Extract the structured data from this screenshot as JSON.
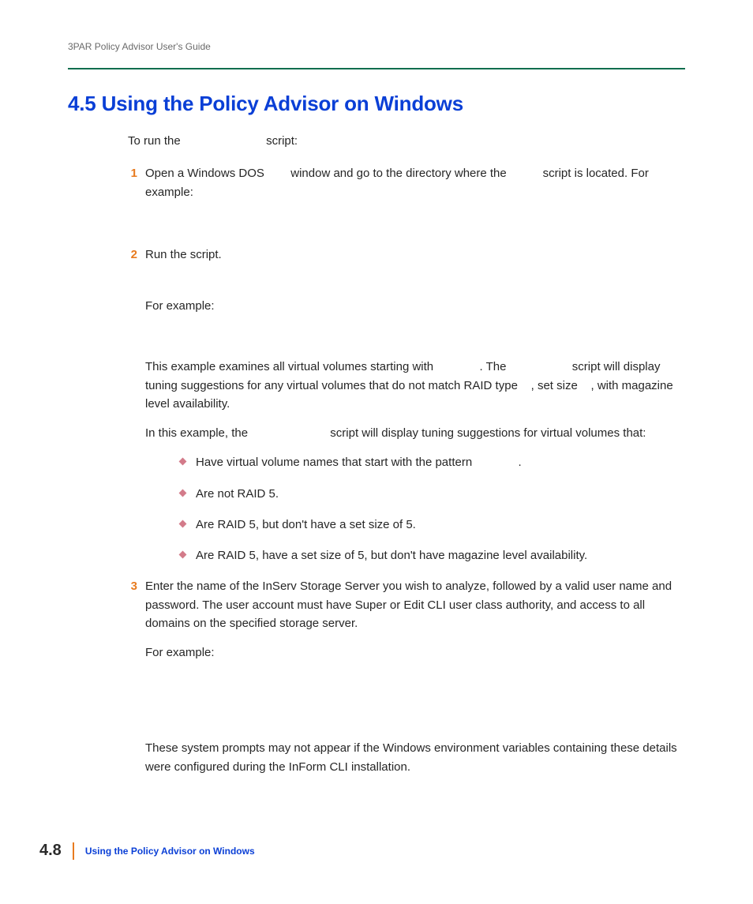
{
  "header": {
    "running": "3PAR Policy Advisor User's Guide"
  },
  "section": {
    "title": "4.5  Using the Policy Advisor on Windows"
  },
  "intro": {
    "pre": "To run the ",
    "post": " script:"
  },
  "steps": {
    "s1": {
      "num": "1",
      "pre": "Open a Windows DOS ",
      "mid": " window and go to the directory where the ",
      "post": "script is located. For example:"
    },
    "s2": {
      "num": "2",
      "line1": "Run the script.",
      "line2": "For example:",
      "p3a": "This example examines all virtual volumes starting with ",
      "p3b": ". The ",
      "p3c": "script will display tuning suggestions for any virtual volumes that do not match RAID type ",
      "p3d": ", set size ",
      "p3e": ", with magazine level availability.",
      "p4a": "In this example, the ",
      "p4b": " script will display tuning suggestions for virtual volumes that:",
      "bullets": {
        "b1a": "Have virtual volume names that start with the pattern ",
        "b1b": ".",
        "b2": "Are not RAID 5.",
        "b3": "Are RAID 5, but don't have a set size of 5.",
        "b4": "Are RAID 5, have a set size of 5, but don't have magazine level availability."
      }
    },
    "s3": {
      "num": "3",
      "p1": "Enter the name of the InServ Storage Server you wish to analyze, followed by a valid user name and password. The user account must have Super or Edit CLI user class authority, and access to all domains on the specified storage server.",
      "p2": "For example:",
      "p3": "These system prompts may not appear if the Windows environment variables containing these details were configured during the InForm CLI installation."
    }
  },
  "footer": {
    "page": "4.8",
    "title": "Using the Policy Advisor on Windows"
  }
}
